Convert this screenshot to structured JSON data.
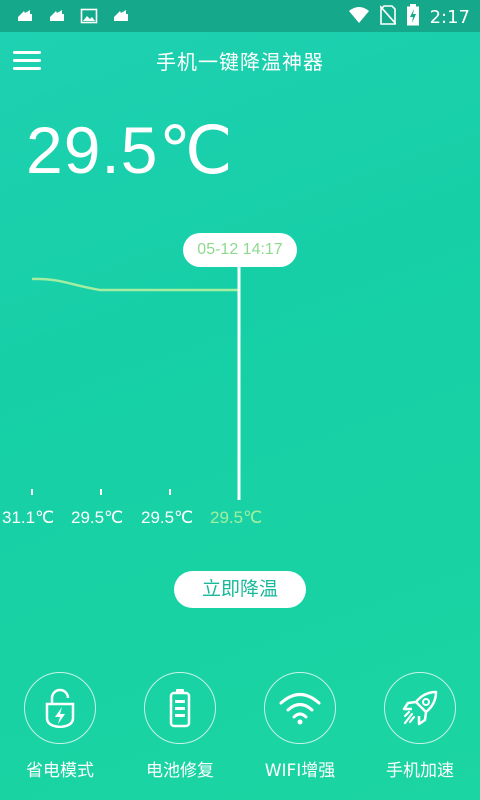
{
  "status_bar": {
    "time": "2:17",
    "left_icons": [
      "app-notification-icon",
      "app-notification-icon",
      "image-icon",
      "app-notification-icon"
    ],
    "right_icons": [
      "wifi-icon",
      "no-sim-icon",
      "battery-icon"
    ]
  },
  "header": {
    "title": "手机一键降温神器"
  },
  "current_temperature": "29.5℃",
  "chart_data": {
    "type": "line",
    "tooltip": "05-12 14:17",
    "tick_labels": [
      "31.1℃",
      "29.5℃",
      "29.5℃",
      "29.5℃"
    ],
    "active_index": 3
  },
  "actions": {
    "cool_down": "立即降温"
  },
  "tools": [
    {
      "label": "省电模式",
      "icon": "lock-bolt-icon"
    },
    {
      "label": "电池修复",
      "icon": "battery-icon"
    },
    {
      "label": "WIFI增强",
      "icon": "wifi-icon"
    },
    {
      "label": "手机加速",
      "icon": "rocket-icon"
    }
  ],
  "colors": {
    "background": "#18d0a8",
    "status_bar": "#16a88a",
    "accent_green": "#a3eea0",
    "button_text": "#19b99a"
  }
}
